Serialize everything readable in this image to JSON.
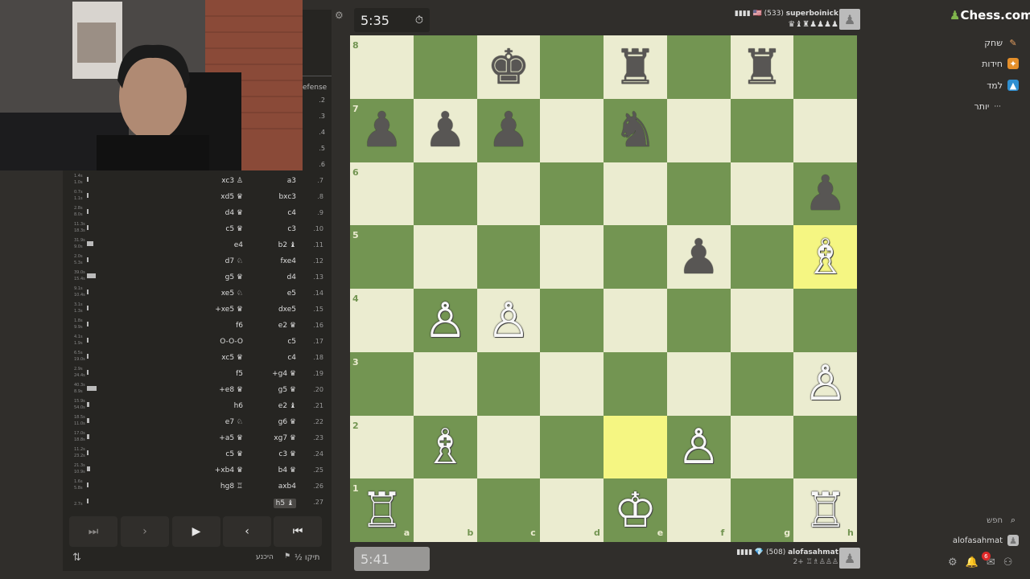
{
  "top_clock": "5:35",
  "bottom_clock": "5:41",
  "top_player": {
    "name": "superboinick",
    "rating": "(533)",
    "flag": "▮▮▮▮ 🇺🇸",
    "material": "♛♝♜♟♟♟♟"
  },
  "bottom_player": {
    "name": "alofasahmat",
    "rating": "(508)",
    "flag": "▮▮▮▮ 💎",
    "material": "2+ ♖♗♙♙♙"
  },
  "opening_fragment": "efense",
  "top_move_numbers": [
    ".2",
    ".3",
    ".4",
    ".5",
    ".6"
  ],
  "moves": [
    {
      "n": ".7",
      "w": "a3",
      "b": "xc3 ♙",
      "t1": "1.4s",
      "t2": "1.0s",
      "bar": 0.04
    },
    {
      "n": ".8",
      "w": "bxc3",
      "b": "xd5 ♛",
      "t1": "0.7s",
      "t2": "1.1s",
      "bar": 0.02
    },
    {
      "n": ".9",
      "w": "c4",
      "b": "d4 ♛",
      "t1": "2.8s",
      "t2": "8.0s",
      "bar": 0.04
    },
    {
      "n": ".10",
      "w": "c3",
      "b": "c5 ♛",
      "t1": "11.3s",
      "t2": "18.3s",
      "bar": 0.06
    },
    {
      "n": ".11",
      "w": "b2 ♝",
      "b": "e4",
      "t1": "31.9s",
      "t2": "9.0s",
      "bar": 0.3
    },
    {
      "n": ".12",
      "w": "fxe4",
      "b": "d7 ♘",
      "t1": "2.0s",
      "t2": "5.3s",
      "bar": 0.04
    },
    {
      "n": ".13",
      "w": "d4",
      "b": "g5 ♛",
      "t1": "39.0s",
      "t2": "15.4s",
      "bar": 0.4
    },
    {
      "n": ".14",
      "w": "e5",
      "b": "xe5 ♘",
      "t1": "9.1s",
      "t2": "10.4s",
      "bar": 0.06
    },
    {
      "n": ".15",
      "w": "dxe5",
      "b": "+xe5 ♛",
      "t1": "3.1s",
      "t2": "1.3s",
      "bar": 0.04
    },
    {
      "n": ".16",
      "w": "e2 ♛",
      "b": "f6",
      "t1": "1.8s",
      "t2": "9.9s",
      "bar": 0.04
    },
    {
      "n": ".17",
      "w": "c5",
      "b": "O-O-O",
      "t1": "4.1s",
      "t2": "1.9s",
      "bar": 0.02
    },
    {
      "n": ".18",
      "w": "c4",
      "b": "xc5 ♛",
      "t1": "6.5s",
      "t2": "19.0s",
      "bar": 0.06
    },
    {
      "n": ".19",
      "w": "+g4 ♛",
      "b": "f5",
      "t1": "2.9s",
      "t2": "24.4s",
      "bar": 0.04
    },
    {
      "n": ".20",
      "w": "g5 ♛",
      "b": "+e8 ♛",
      "t1": "40.3s",
      "t2": "8.9s",
      "bar": 0.42
    },
    {
      "n": ".21",
      "w": "e2 ♝",
      "b": "h6",
      "t1": "15.9s",
      "t2": "54.0s",
      "bar": 0.1
    },
    {
      "n": ".22",
      "w": "g6 ♛",
      "b": "e7 ♘",
      "t1": "18.5s",
      "t2": "11.0s",
      "bar": 0.1
    },
    {
      "n": ".23",
      "w": "xg7 ♛",
      "b": "+a5 ♛",
      "t1": "17.0s",
      "t2": "18.8s",
      "bar": 0.1
    },
    {
      "n": ".24",
      "w": "c3 ♛",
      "b": "c5 ♛",
      "t1": "11.2s",
      "t2": "23.2s",
      "bar": 0.08
    },
    {
      "n": ".25",
      "w": "b4 ♛",
      "b": "+xb4 ♛",
      "t1": "21.3s",
      "t2": "10.9s",
      "bar": 0.14
    },
    {
      "n": ".26",
      "w": "axb4",
      "b": "hg8 ♖",
      "t1": "1.6s",
      "t2": "5.8s",
      "bar": 0.04
    },
    {
      "n": ".27",
      "w": "h5 ♝",
      "b": "",
      "t1": "",
      "t2": "2.7s",
      "bar": 0.02,
      "current": true
    }
  ],
  "bottom_actions": {
    "draw": "½ תיקו",
    "resign": "היכנע",
    "flip": "⇅"
  },
  "files": [
    "a",
    "b",
    "c",
    "d",
    "e",
    "f",
    "g",
    "h"
  ],
  "ranks": [
    "8",
    "7",
    "6",
    "5",
    "4",
    "3",
    "2",
    "1"
  ],
  "position": [
    [
      "",
      "",
      "♚",
      "",
      "♜",
      "",
      "♜",
      ""
    ],
    [
      "♟",
      "♟",
      "♟",
      "",
      "♞",
      "",
      "",
      ""
    ],
    [
      "",
      "",
      "",
      "",
      "",
      "",
      "",
      "♟"
    ],
    [
      "",
      "",
      "",
      "",
      "",
      "♟",
      "",
      "♗"
    ],
    [
      "",
      "♙",
      "♙",
      "",
      "",
      "",
      "",
      ""
    ],
    [
      "",
      "",
      "",
      "",
      "",
      "",
      "",
      "♙"
    ],
    [
      "",
      "♗",
      "",
      "",
      "",
      "♙",
      "",
      ""
    ],
    [
      "♖",
      "",
      "",
      "",
      "♔",
      "",
      "",
      "♖"
    ]
  ],
  "highlights": [
    "h5",
    "e2"
  ],
  "nav": {
    "logo": "Chess.com",
    "items": [
      "שחק",
      "חידות",
      "למד",
      "יותר"
    ],
    "search": "חפש",
    "username": "alofasahmat",
    "notification_count": "6"
  },
  "colors": {
    "light": "#ebecd0",
    "dark": "#739552",
    "highlight": "#f5f682",
    "bg": "#302e2b"
  }
}
